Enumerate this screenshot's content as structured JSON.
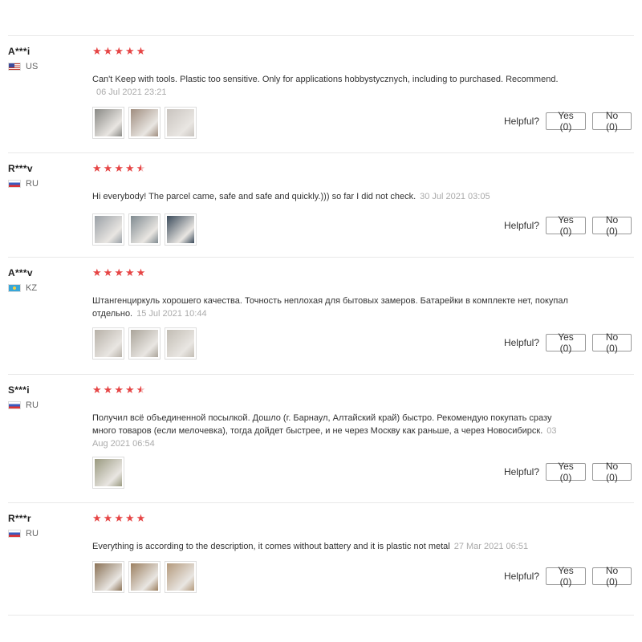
{
  "helpful_label": "Helpful?",
  "reviews": [
    {
      "user": "A***i",
      "country": "US",
      "flag": "us",
      "rating": 5,
      "text": "Can't Keep with tools. Plastic too sensitive. Only for applications hobbystycznych, including to purchased. Recommend.",
      "date": "06 Jul 2021 23:21",
      "date_newline": true,
      "photos": [
        "#8a8a86",
        "#a08e80",
        "#c9c4bf"
      ],
      "yes": "Yes (0)",
      "no": "No (0)"
    },
    {
      "user": "R***v",
      "country": "RU",
      "flag": "ru",
      "rating": 4.5,
      "text": "Hi everybody! The parcel came, safe and safe and quickly.))) so far I did not check.",
      "date": "30 Jul 2021 03:05",
      "date_newline": false,
      "photos": [
        "#9aa0a6",
        "#7f8a90",
        "#3a4a5a"
      ],
      "yes": "Yes (0)",
      "no": "No (0)"
    },
    {
      "user": "A***v",
      "country": "KZ",
      "flag": "kz",
      "rating": 5,
      "text": "Штангенциркуль хорошего качества. Точность неплохая для бытовых замеров. Батарейки в комплекте нет, покупал отдельно.",
      "date": "15 Jul 2021 10:44",
      "date_newline": false,
      "photos": [
        "#b7b1a8",
        "#aaa49a",
        "#c2bdb4"
      ],
      "yes": "Yes (0)",
      "no": "No (0)"
    },
    {
      "user": "S***i",
      "country": "RU",
      "flag": "ru",
      "rating": 4.5,
      "text": "Получил всё объединенной посылкой. Дошло (г. Барнаул, Алтайский край) быстро. Рекомендую покупать сразу много товаров (если мелочевка), тогда дойдет быстрее, и не через Москву как раньше, а через Новосибирск.",
      "date": "03 Aug 2021 06:54",
      "date_newline": false,
      "photos": [
        "#9a9a80"
      ],
      "yes": "Yes (0)",
      "no": "No (0)"
    },
    {
      "user": "R***r",
      "country": "RU",
      "flag": "ru",
      "rating": 5,
      "text": "Everything is according to the description, it comes without battery and it is plastic not metal",
      "date": "27 Mar 2021 06:51",
      "date_newline": false,
      "photos": [
        "#8b7256",
        "#9c8060",
        "#b49a7c"
      ],
      "yes": "Yes (0)",
      "no": "No (0)"
    }
  ]
}
